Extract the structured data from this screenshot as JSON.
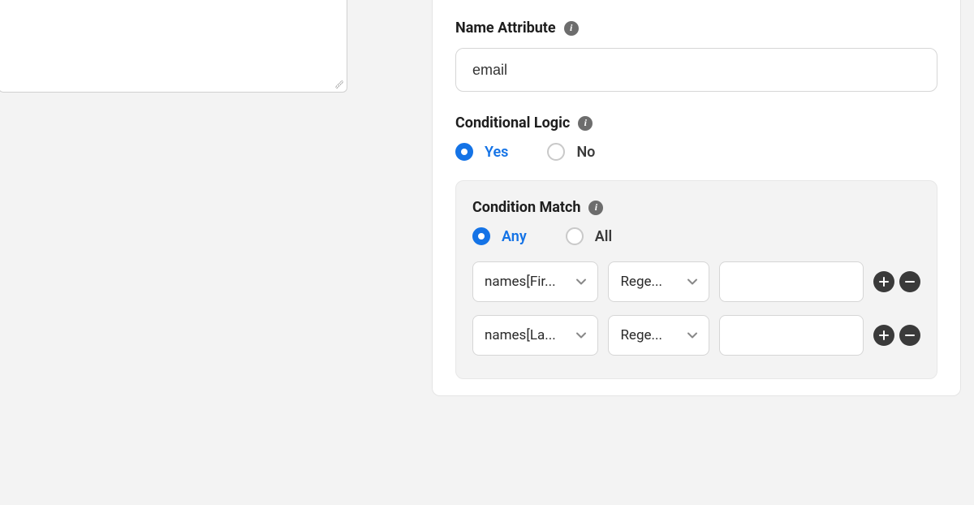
{
  "leftTextarea": {
    "value": ""
  },
  "nameAttribute": {
    "label": "Name Attribute",
    "value": "email"
  },
  "conditionalLogic": {
    "label": "Conditional Logic",
    "selected": "yes",
    "options": {
      "yes": "Yes",
      "no": "No"
    }
  },
  "conditionMatch": {
    "label": "Condition Match",
    "selected": "any",
    "options": {
      "any": "Any",
      "all": "All"
    },
    "rows": [
      {
        "field": "names[Fir...",
        "operator": "Rege...",
        "value": ""
      },
      {
        "field": "names[La...",
        "operator": "Rege...",
        "value": ""
      }
    ]
  }
}
